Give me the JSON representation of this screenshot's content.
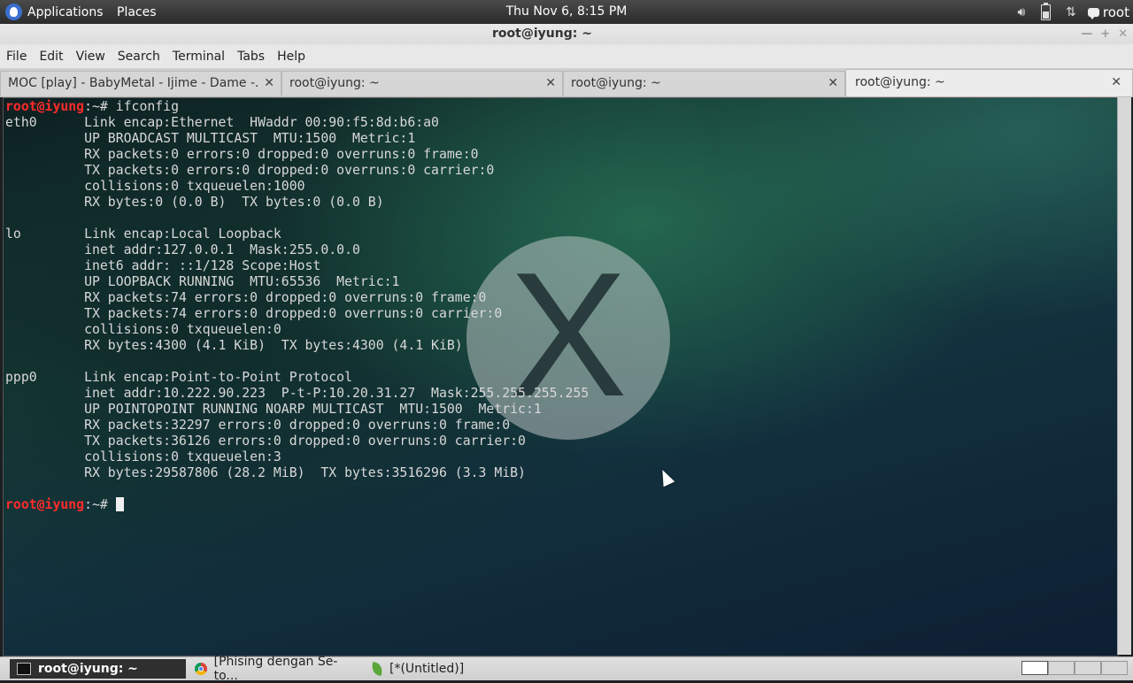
{
  "top_panel": {
    "applications_label": "Applications",
    "places_label": "Places",
    "clock": "Thu Nov  6,  8:15 PM",
    "user_label": "root"
  },
  "window": {
    "title": "root@iyung: ~"
  },
  "menu": {
    "file": "File",
    "edit": "Edit",
    "view": "View",
    "search": "Search",
    "terminal": "Terminal",
    "tabs": "Tabs",
    "help": "Help"
  },
  "tabs": [
    {
      "label": "MOC [play] - BabyMetal - Ijime - Dame -..."
    },
    {
      "label": "root@iyung: ~"
    },
    {
      "label": "root@iyung: ~"
    },
    {
      "label": "root@iyung: ~",
      "active": true
    }
  ],
  "terminal": {
    "prompt_user": "root@iyung",
    "prompt_path": ":~#",
    "command": " ifconfig",
    "output": "eth0      Link encap:Ethernet  HWaddr 00:90:f5:8d:b6:a0  \n          UP BROADCAST MULTICAST  MTU:1500  Metric:1\n          RX packets:0 errors:0 dropped:0 overruns:0 frame:0\n          TX packets:0 errors:0 dropped:0 overruns:0 carrier:0\n          collisions:0 txqueuelen:1000 \n          RX bytes:0 (0.0 B)  TX bytes:0 (0.0 B)\n\nlo        Link encap:Local Loopback  \n          inet addr:127.0.0.1  Mask:255.0.0.0\n          inet6 addr: ::1/128 Scope:Host\n          UP LOOPBACK RUNNING  MTU:65536  Metric:1\n          RX packets:74 errors:0 dropped:0 overruns:0 frame:0\n          TX packets:74 errors:0 dropped:0 overruns:0 carrier:0\n          collisions:0 txqueuelen:0 \n          RX bytes:4300 (4.1 KiB)  TX bytes:4300 (4.1 KiB)\n\nppp0      Link encap:Point-to-Point Protocol  \n          inet addr:10.222.90.223  P-t-P:10.20.31.27  Mask:255.255.255.255\n          UP POINTOPOINT RUNNING NOARP MULTICAST  MTU:1500  Metric:1\n          RX packets:32297 errors:0 dropped:0 overruns:0 frame:0\n          TX packets:36126 errors:0 dropped:0 overruns:0 carrier:0\n          collisions:0 txqueuelen:3 \n          RX bytes:29587806 (28.2 MiB)  TX bytes:3516296 (3.3 MiB)\n",
    "wallpaper_logo_letter": "X"
  },
  "taskbar": [
    {
      "label": "root@iyung: ~",
      "icon": "terminal-icon",
      "active": true
    },
    {
      "label": "[Phising dengan Se-to...",
      "icon": "chrome-icon"
    },
    {
      "label": "[*(Untitled)]",
      "icon": "gedit-icon"
    }
  ],
  "colors": {
    "prompt_user": "#ff2b2b",
    "terminal_text": "#d8d8d8"
  }
}
